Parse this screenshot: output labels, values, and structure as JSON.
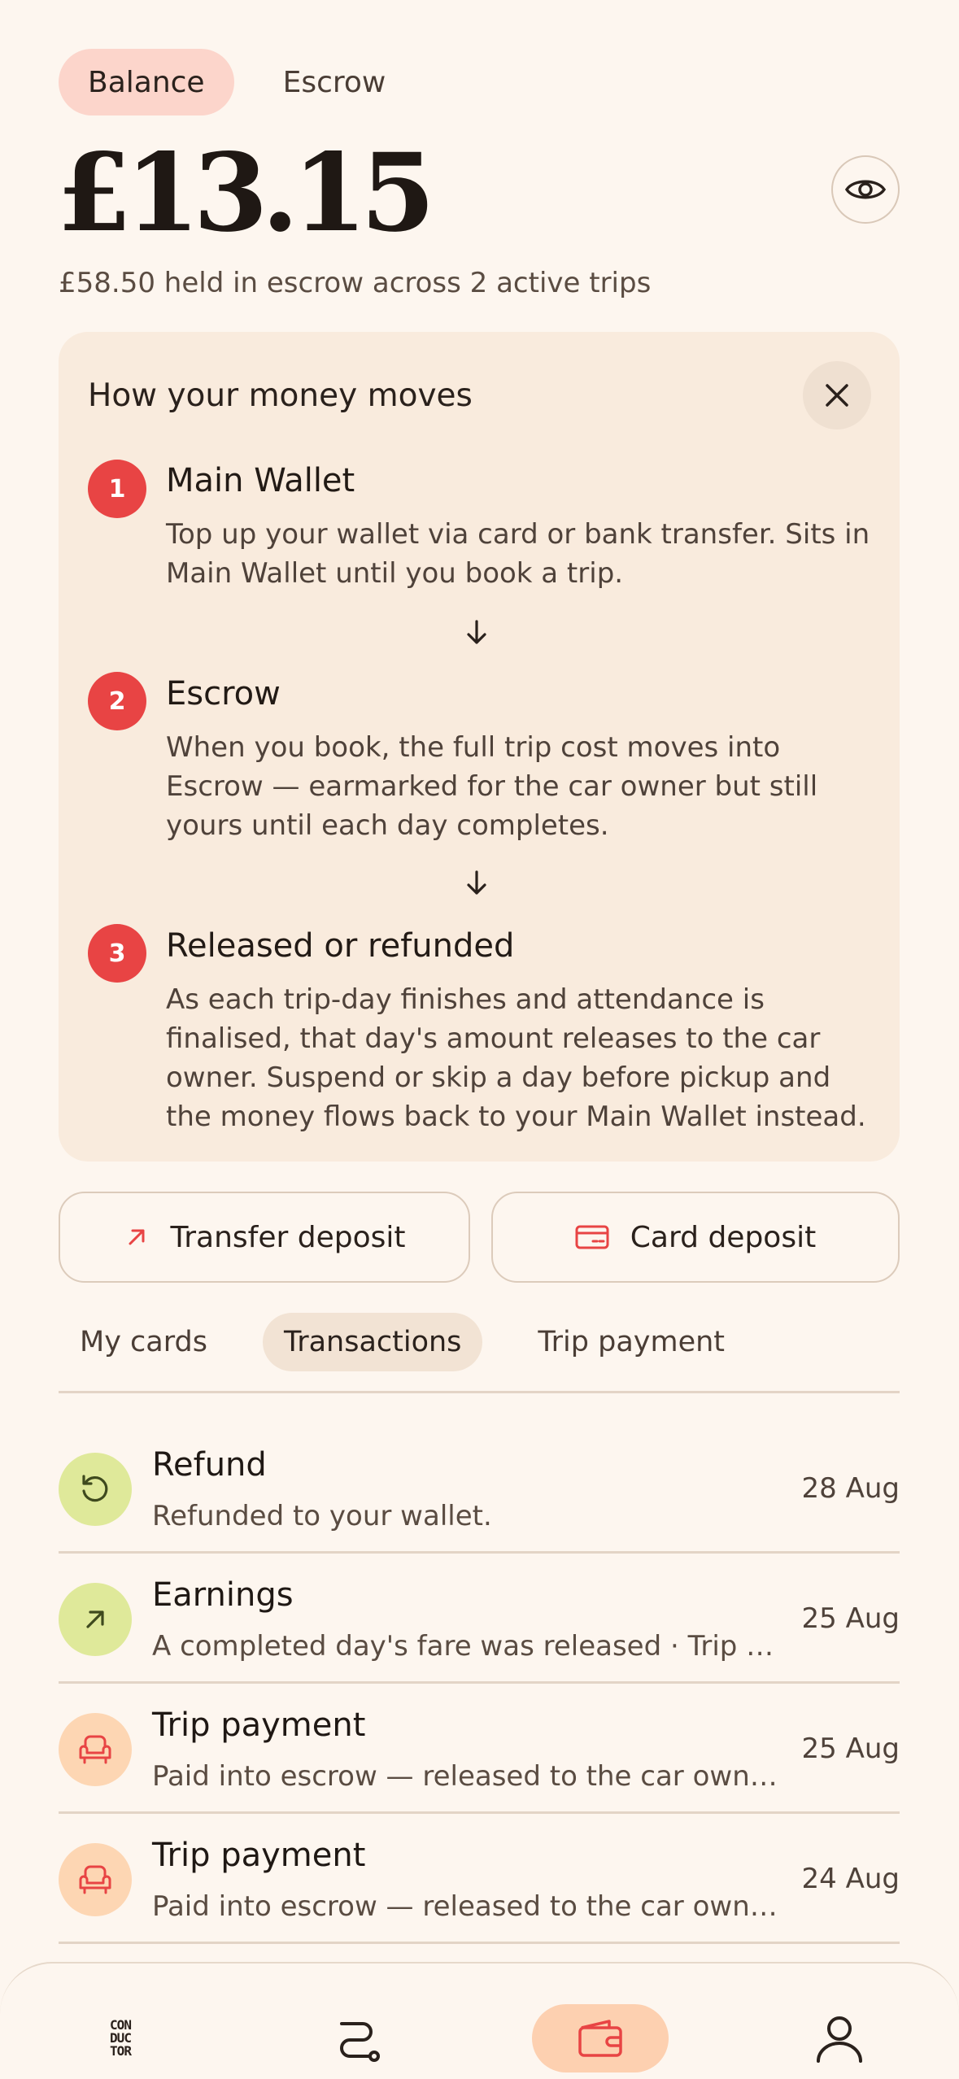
{
  "top_tabs": [
    {
      "label": "Balance",
      "active": true
    },
    {
      "label": "Escrow",
      "active": false
    }
  ],
  "balance": {
    "amount": "£13.15",
    "escrow_summary": "£58.50 held in escrow across 2 active trips"
  },
  "info_card": {
    "title": "How your money moves",
    "steps": [
      {
        "number": "1",
        "title": "Main Wallet",
        "description": "Top up your wallet via card or bank transfer. Sits in Main Wallet until you book a trip."
      },
      {
        "number": "2",
        "title": "Escrow",
        "description": "When you book, the full trip cost moves into Escrow — earmarked for the car owner but still yours until each day completes."
      },
      {
        "number": "3",
        "title": "Released or refunded",
        "description": "As each trip-day finishes and attendance is finalised, that day's amount releases to the car owner. Suspend or skip a day before pickup and the money flows back to your Main Wallet instead."
      }
    ]
  },
  "deposit_buttons": {
    "transfer_label": "Transfer deposit",
    "card_label": "Card deposit"
  },
  "section_tabs": [
    {
      "label": "My cards",
      "active": false
    },
    {
      "label": "Transactions",
      "active": true
    },
    {
      "label": "Trip payment",
      "active": false
    }
  ],
  "transactions": [
    {
      "type": "refund",
      "title": "Refund",
      "subtitle": "Refunded to your wallet.",
      "date": "28 Aug",
      "icon": "refund-icon"
    },
    {
      "type": "earnings",
      "title": "Earnings",
      "subtitle": "A completed day's fare was released · Trip #...",
      "date": "25 Aug",
      "icon": "arrow-up-right-icon"
    },
    {
      "type": "trip",
      "title": "Trip payment",
      "subtitle": "Paid into escrow — released to the car owner...",
      "date": "25 Aug",
      "icon": "seat-icon"
    },
    {
      "type": "trip",
      "title": "Trip payment",
      "subtitle": "Paid into escrow — released to the car owner...",
      "date": "24 Aug",
      "icon": "seat-icon"
    }
  ],
  "bottom_nav": {
    "logo_lines": [
      "CON",
      "DUC",
      "TOR"
    ],
    "items": [
      "home-logo-icon",
      "route-icon",
      "wallet-icon",
      "profile-icon"
    ],
    "active": "wallet-icon"
  },
  "colors": {
    "background": "#fdf6ef",
    "accent_red": "#e84444",
    "pink_tab": "#fcd5cb",
    "card_bg": "#f9ebdd",
    "green_icon_bg": "#dfe99a",
    "orange_icon_bg": "#fdd6b3"
  }
}
